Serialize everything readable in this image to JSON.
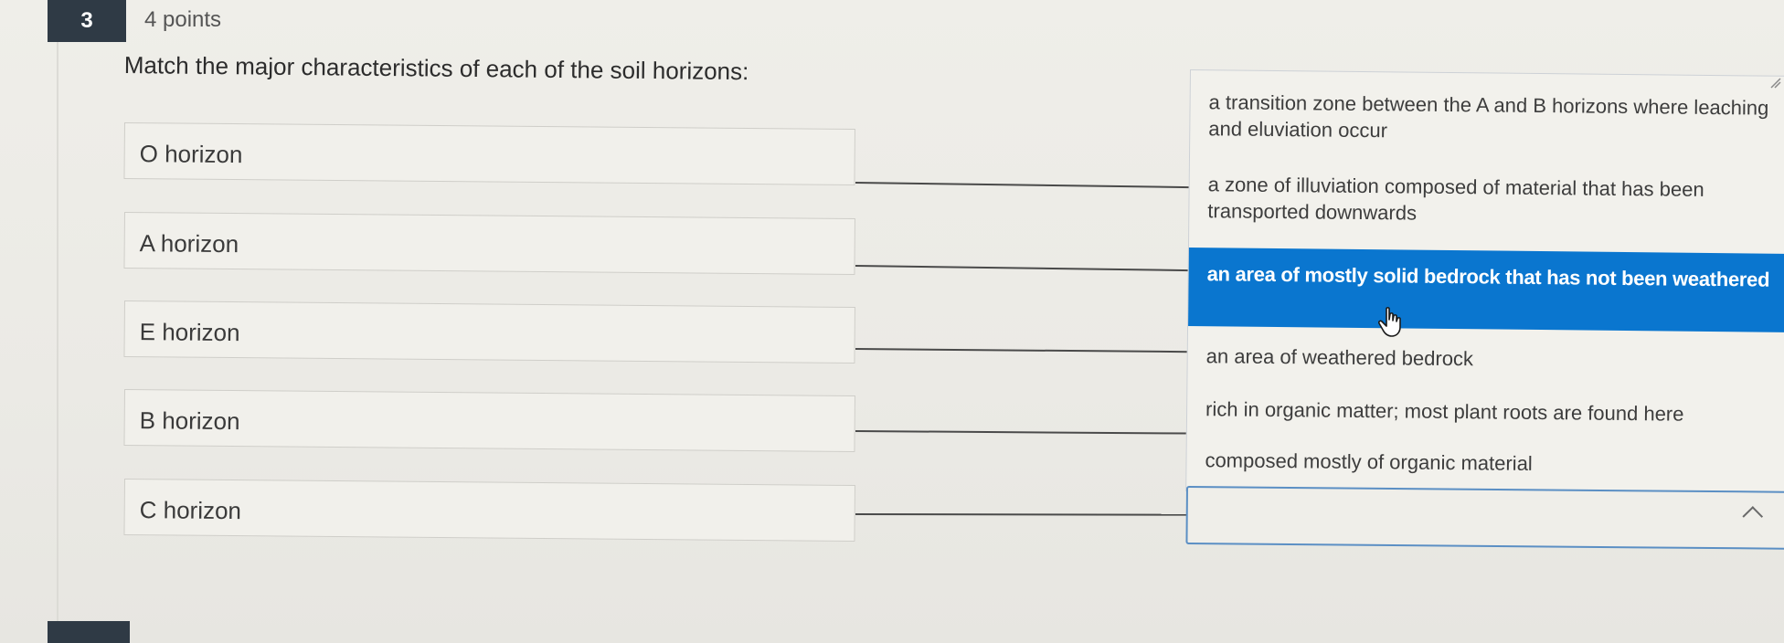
{
  "question": {
    "number": "3",
    "points": "4 points",
    "prompt": "Match the major characteristics of each of the soil horizons:"
  },
  "terms": [
    {
      "label": "O horizon"
    },
    {
      "label": "A horizon"
    },
    {
      "label": "E horizon"
    },
    {
      "label": "B horizon"
    },
    {
      "label": "C horizon"
    }
  ],
  "dropdown": {
    "options": [
      {
        "label": "a transition zone between the A and B horizons where leaching and eluviation occur"
      },
      {
        "label": "a zone of illuviation composed of material that has been transported downwards"
      },
      {
        "label": "an area of mostly solid bedrock that has not been weathered",
        "highlighted": true
      },
      {
        "label": "an area of weathered bedrock"
      },
      {
        "label": "rich in organic matter; most plant roots are found here"
      },
      {
        "label": "composed mostly of organic material"
      }
    ],
    "selected_value": ""
  },
  "colors": {
    "highlight": "#0a76cf",
    "badge": "#2f3a45",
    "select_border": "#5b8fc4"
  },
  "icons": {
    "cursor": "hand-pointer-icon",
    "chevron": "chevron-up-icon"
  }
}
